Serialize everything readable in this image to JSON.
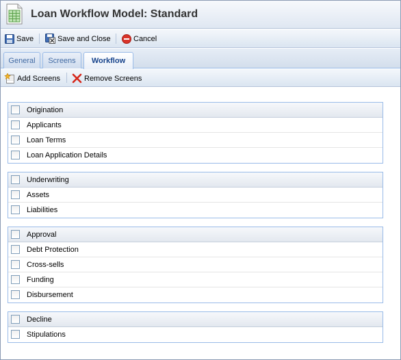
{
  "window": {
    "title": "Loan Workflow Model: Standard",
    "icon": "spreadsheet-icon"
  },
  "toolbar": {
    "save_label": "Save",
    "save_close_label": "Save and Close",
    "cancel_label": "Cancel"
  },
  "tabs": [
    {
      "label": "General",
      "active": false
    },
    {
      "label": "Screens",
      "active": false
    },
    {
      "label": "Workflow",
      "active": true
    }
  ],
  "subtoolbar": {
    "add_label": "Add Screens",
    "remove_label": "Remove Screens"
  },
  "groups": [
    {
      "header": "Origination",
      "items": [
        "Applicants",
        "Loan Terms",
        "Loan Application Details"
      ]
    },
    {
      "header": "Underwriting",
      "items": [
        "Assets",
        "Liabilities"
      ]
    },
    {
      "header": "Approval",
      "items": [
        "Debt Protection",
        "Cross-sells",
        "Funding",
        "Disbursement"
      ]
    },
    {
      "header": "Decline",
      "items": [
        "Stipulations"
      ]
    }
  ],
  "colors": {
    "accent": "#15428b",
    "border": "#99bbe8",
    "cancel_red": "#d9342b"
  }
}
